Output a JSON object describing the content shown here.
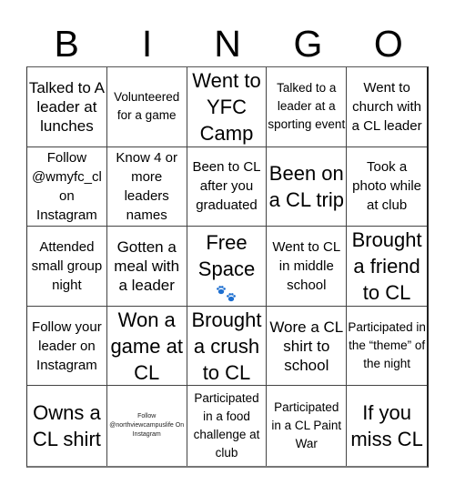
{
  "title_letters": [
    "B",
    "I",
    "N",
    "G",
    "O"
  ],
  "colors": {
    "paw_icon": "#1e6fd0",
    "grid_line": "#444444",
    "text": "#000000"
  },
  "cells": [
    {
      "text": "Talked to A leader at lunches",
      "size": "lg"
    },
    {
      "text": "Volunteered for a game",
      "size": "sm"
    },
    {
      "text": "Went to YFC Camp",
      "size": "xl"
    },
    {
      "text": "Talked to a leader at a sporting event",
      "size": "sm"
    },
    {
      "text": "Went to church with a CL leader",
      "size": "md"
    },
    {
      "text": "Follow @wmyfc_cl on Instagram",
      "size": "md"
    },
    {
      "text": "Know 4 or more leaders names",
      "size": "md"
    },
    {
      "text": "Been to CL after you graduated",
      "size": "md"
    },
    {
      "text": "Been on a CL trip",
      "size": "xl"
    },
    {
      "text": "Took a photo while at club",
      "size": "md"
    },
    {
      "text": "Attended small group night",
      "size": "md"
    },
    {
      "text": "Gotten a meal with a leader",
      "size": "lg"
    },
    {
      "text": "Free Space",
      "size": "xl",
      "icon": "paw-prints-icon"
    },
    {
      "text": "Went to CL in middle school",
      "size": "md"
    },
    {
      "text": "Brought a friend to CL",
      "size": "xl"
    },
    {
      "text": "Follow your leader on Instagram",
      "size": "md"
    },
    {
      "text": "Won a game at CL",
      "size": "xl"
    },
    {
      "text": "Brought a crush to CL",
      "size": "xl"
    },
    {
      "text": "Wore a CL shirt to school",
      "size": "lg"
    },
    {
      "text": "Participated in the “theme” of the night",
      "size": "sm"
    },
    {
      "text": "Owns a CL shirt",
      "size": "xl"
    },
    {
      "text": "Follow @northviewcampuslife On Instagram",
      "size": "xs"
    },
    {
      "text": "Participated in a food challenge at club",
      "size": "sm"
    },
    {
      "text": "Participated in a CL Paint War",
      "size": "sm"
    },
    {
      "text": "If you miss CL",
      "size": "xl"
    }
  ]
}
